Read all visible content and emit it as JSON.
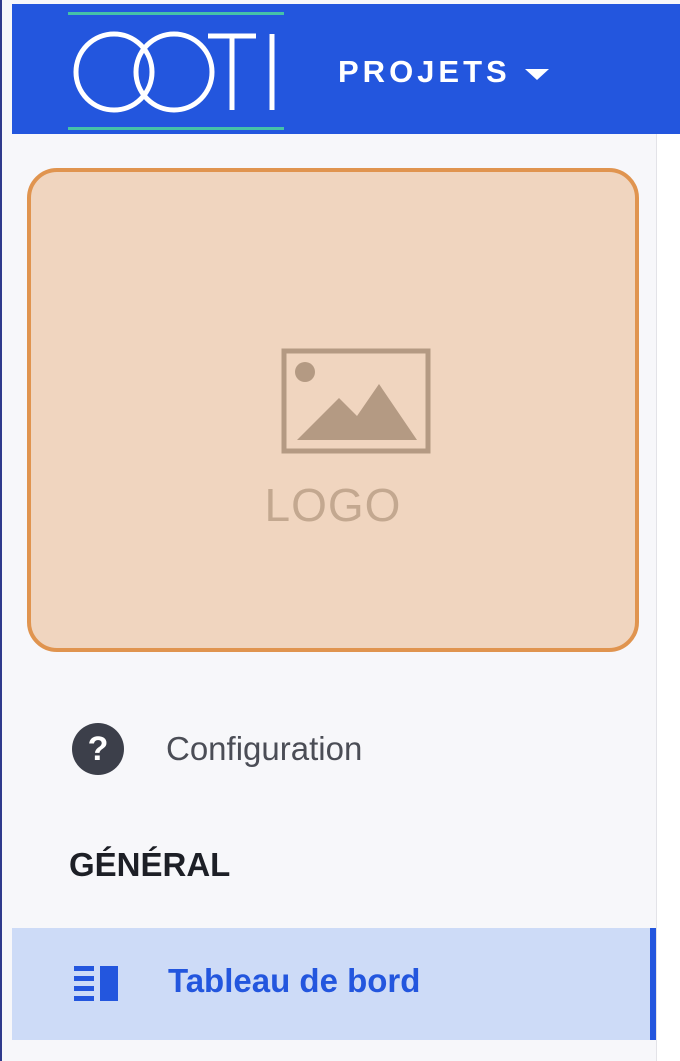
{
  "header": {
    "brand_logo": "OOTI",
    "menu_label": "PROJETS",
    "menu_icon": "caret-down-icon",
    "colors": {
      "bar": "#2356de",
      "brand_rule": "#45c2a8"
    }
  },
  "sidebar": {
    "logo_placeholder": {
      "icon": "image-placeholder-icon",
      "label": "LOGO",
      "colors": {
        "fill": "#f0d5bf",
        "border": "#e0944f"
      }
    },
    "config_item": {
      "icon": "help-circle-icon",
      "label": "Configuration"
    },
    "section_title": "GÉNÉRAL",
    "items": [
      {
        "icon": "dashboard-icon",
        "label": "Tableau de bord",
        "active": true
      }
    ]
  }
}
